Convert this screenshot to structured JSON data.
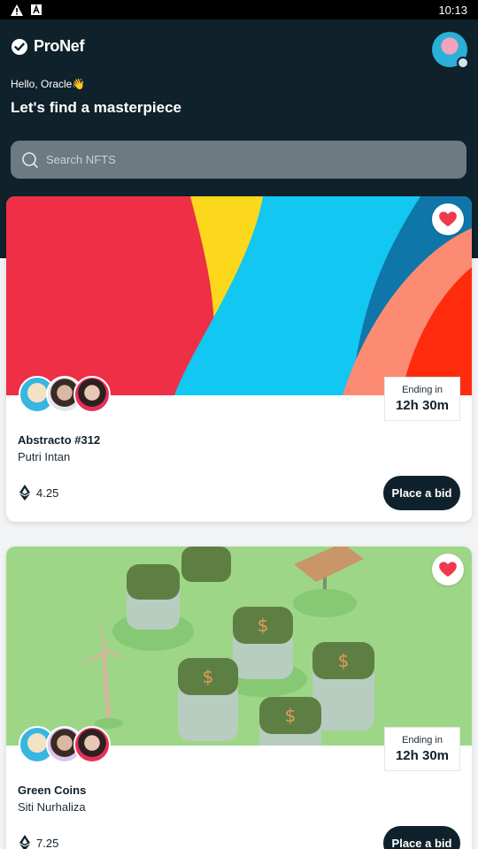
{
  "status_bar": {
    "time": "10:13",
    "icons": [
      "warning-icon",
      "app-icon"
    ]
  },
  "header": {
    "brand": "ProNef",
    "greeting": "Hello, Oracle👋",
    "headline": "Let's find a masterpiece",
    "search_placeholder": "Search NFTS"
  },
  "nfts": [
    {
      "title": "Abstracto #312",
      "creator": "Putri Intan",
      "price": "4.25",
      "ending_label": "Ending in",
      "ending_time": "12h 30m",
      "bid_label": "Place a bid",
      "favorited": true
    },
    {
      "title": "Green Coins",
      "creator": "Siti Nurhaliza",
      "price": "7.25",
      "ending_label": "Ending in",
      "ending_time": "12h 30m",
      "bid_label": "Place a bid",
      "favorited": true
    }
  ],
  "colors": {
    "header_bg": "#0f212b",
    "accent": "#f0384f",
    "search_bg": "#6c7a82"
  }
}
